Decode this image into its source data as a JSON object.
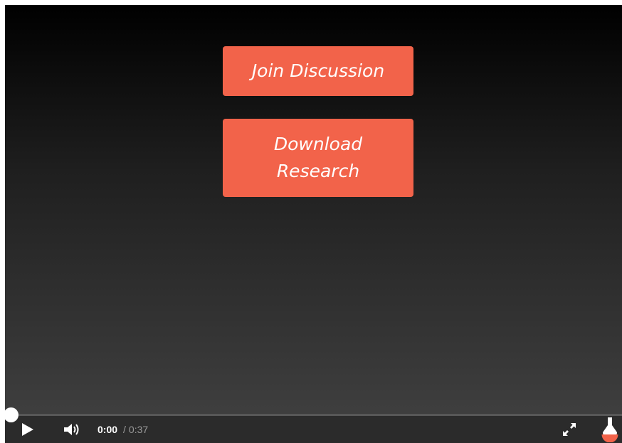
{
  "cta": {
    "join_label": "Join Discussion",
    "download_label": "Download Research"
  },
  "controls": {
    "current_time": "0:00",
    "separator": "/",
    "duration": "0:37",
    "progress_fraction": 0.0
  },
  "colors": {
    "cta_background": "#f2634a",
    "player_bar": "#2b2b2b"
  },
  "icons": {
    "play": "play-icon",
    "volume": "volume-icon",
    "fullscreen": "fullscreen-icon",
    "brand": "flask-logo-icon"
  }
}
